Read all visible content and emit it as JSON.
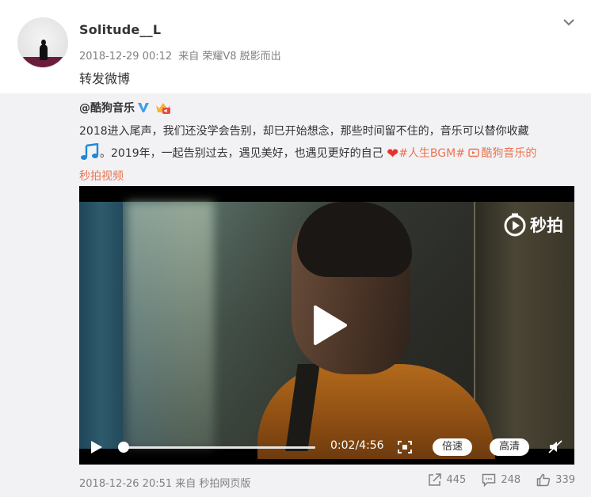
{
  "post": {
    "username": "Solitude__L",
    "timestamp": "2018-12-29 00:12",
    "from_label": "来自",
    "device": "荣耀V8 脱影而出",
    "text": "转发微博"
  },
  "original": {
    "author": "@酷狗音乐",
    "text_line1": "2018进入尾声，我们还没学会告别，却已开始想念，那些时间留不住的，音乐可以替你收藏",
    "text_line2": "。2019年，一起告别过去，遇见美好，也遇见更好的自己",
    "hashtag": "#人生BGM#",
    "link_text": "酷狗音乐的",
    "link_text2": "秒拍视频",
    "video": {
      "brand": "秒拍",
      "time": "0:02/4:56",
      "progress": 0.007,
      "speed_label": "倍速",
      "quality_label": "高清"
    },
    "date": "2018-12-26 20:51",
    "source": "来自 秒拍网页版",
    "reposts": "445",
    "comments": "248",
    "likes": "339"
  },
  "colors": {
    "link": "#eb7350",
    "verified": "#3d9ee7",
    "heart": "#e8322e",
    "muted": "#808080",
    "card_bg": "#f2f2f5"
  },
  "icons": [
    "chevron-down-icon",
    "verified-icon",
    "crown-badge-icon",
    "music-note-icon",
    "heart-icon",
    "video-link-icon",
    "miaopai-logo-icon",
    "play-icon",
    "fullscreen-icon",
    "mute-icon",
    "repost-icon",
    "comment-icon",
    "like-icon"
  ]
}
